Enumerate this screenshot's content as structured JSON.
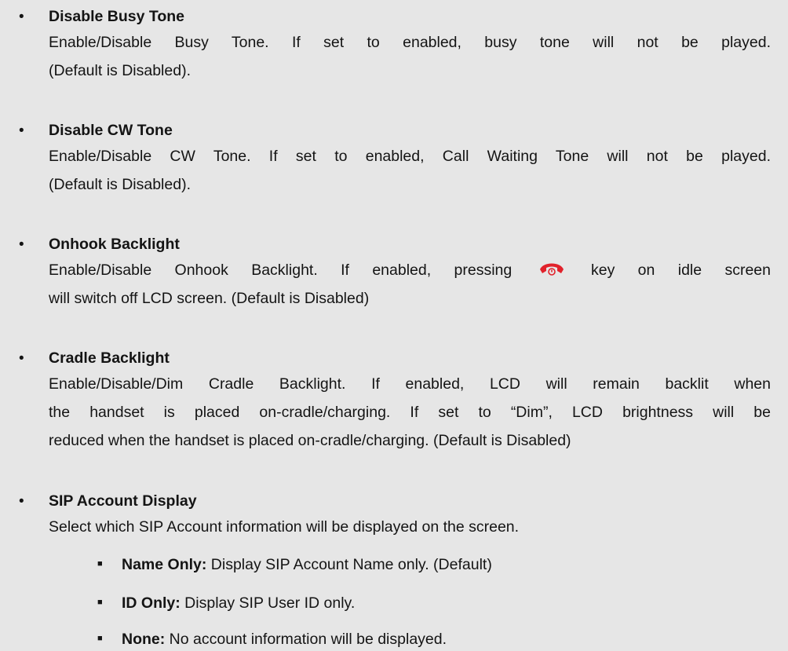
{
  "items": [
    {
      "title": "Disable Busy Tone",
      "desc_lines": [
        "Enable/Disable Busy Tone. If set to enabled, busy tone will not be played.",
        "(Default is Disabled)."
      ]
    },
    {
      "title": "Disable CW Tone",
      "desc_lines": [
        "Enable/Disable CW Tone. If set to enabled, Call Waiting Tone will not be played.",
        "(Default is Disabled)."
      ]
    },
    {
      "title": "Onhook Backlight",
      "desc_line1_before": "Enable/Disable Onhook Backlight. If enabled, pressing",
      "desc_line1_after": "key on idle screen",
      "desc_line2": "will switch off LCD screen. (Default is Disabled)",
      "icon": "hang-up-key-icon",
      "icon_color": "#e1222b"
    },
    {
      "title": "Cradle Backlight",
      "desc_lines": [
        "Enable/Disable/Dim Cradle Backlight. If enabled, LCD will remain backlit when",
        "the handset is placed on-cradle/charging. If set to “Dim”, LCD brightness will be",
        "reduced when the handset is placed on-cradle/charging. (Default is Disabled)"
      ]
    },
    {
      "title": "SIP Account Display",
      "desc_lines": [
        "Select which SIP Account information will be displayed on the screen."
      ],
      "options": [
        {
          "label": "Name Only:",
          "text": " Display SIP Account Name only. (Default)"
        },
        {
          "label": "ID Only:",
          "text": " Display SIP User ID only."
        },
        {
          "label": "None:",
          "text": " No account information will be displayed."
        }
      ]
    }
  ],
  "bullet_char": "•",
  "sub_bullet_char": "■"
}
